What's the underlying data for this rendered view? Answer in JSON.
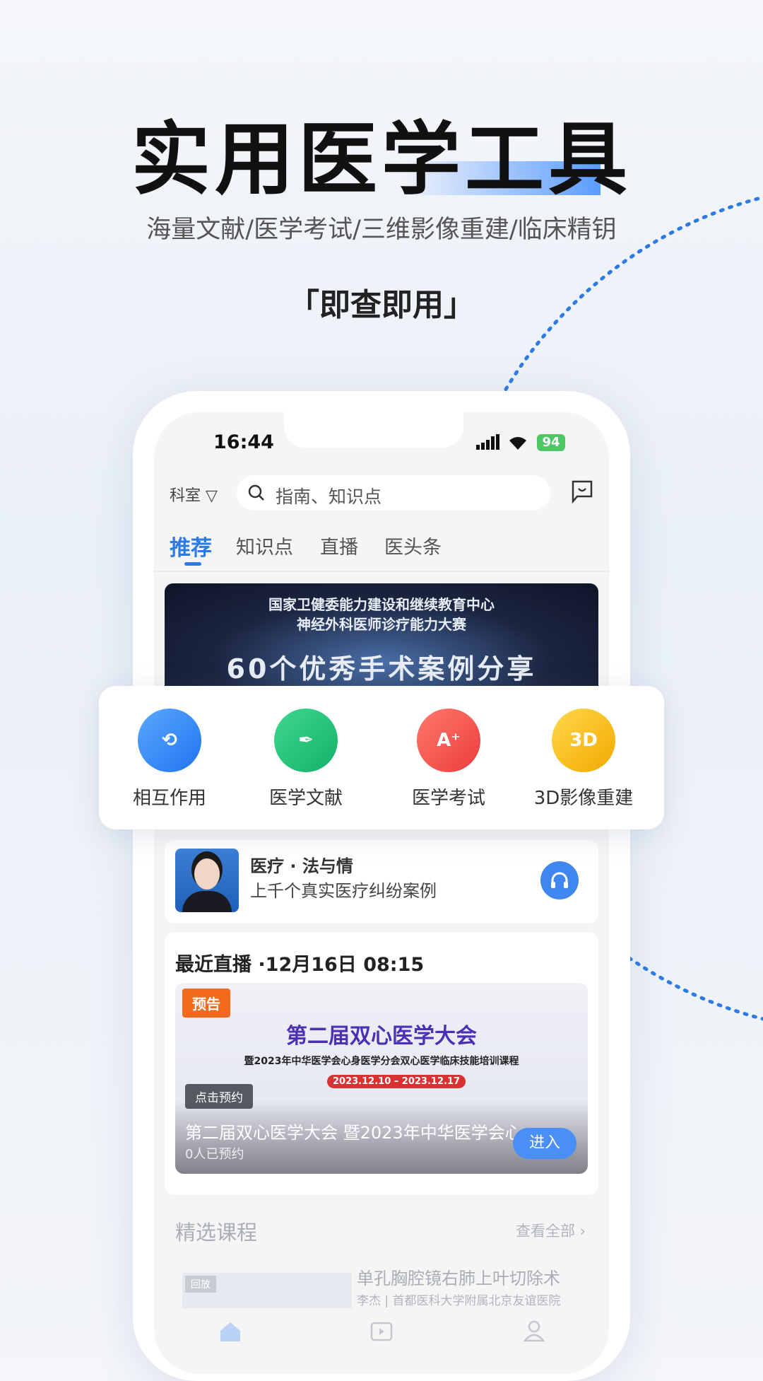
{
  "hero": {
    "title": "实用医学工具",
    "subtitle": "海量文献/医学考试/三维影像重建/临床精钥",
    "slogan": "「即查即用」"
  },
  "status": {
    "time": "16:44",
    "battery": "94"
  },
  "header": {
    "dept": "科室",
    "dept_icon": "filter-icon",
    "search_placeholder": "指南、知识点"
  },
  "tabs": [
    {
      "label": "推荐",
      "active": true
    },
    {
      "label": "知识点"
    },
    {
      "label": "直播"
    },
    {
      "label": "医头条"
    }
  ],
  "banner": {
    "line1": "国家卫健委能力建设和继续教育中心",
    "line2": "神经外科医师诊疗能力大赛",
    "headline": "60个优秀手术案例分享"
  },
  "tools": [
    {
      "label": "相互作用",
      "icon": "interaction-icon",
      "color": "#2f86f0"
    },
    {
      "label": "医学文献",
      "icon": "pen-icon",
      "color": "#22c07a"
    },
    {
      "label": "医学考试",
      "icon": "exam-icon",
      "color": "#f0514c"
    },
    {
      "label": "3D影像重建",
      "icon": "3d-icon",
      "color": "#f5b800"
    }
  ],
  "podcast": {
    "title": "医疗 · 法与情",
    "desc": "上千个真实医疗纠纷案例"
  },
  "live": {
    "title": "最近直播 ·12月16日 08:15",
    "badge": "预告",
    "poster_title": "第二届双心医学大会",
    "poster_sub": "暨2023年中华医学会心身医学分会双心医学临床技能培训课程",
    "poster_date": "2023.12.10 – 2023.12.17",
    "reserve": "点击预约",
    "name": "第二届双心医学大会 暨2023年中华医学会心",
    "count": "0人已预约",
    "enter": "进入"
  },
  "courses": {
    "title": "精选课程",
    "view_all": "查看全部 ›",
    "item_title": "单孔胸腔镜右肺上叶切除术",
    "item_sub": "李杰 | 首都医科大学附属北京友谊医院",
    "item_badge": "回放"
  }
}
